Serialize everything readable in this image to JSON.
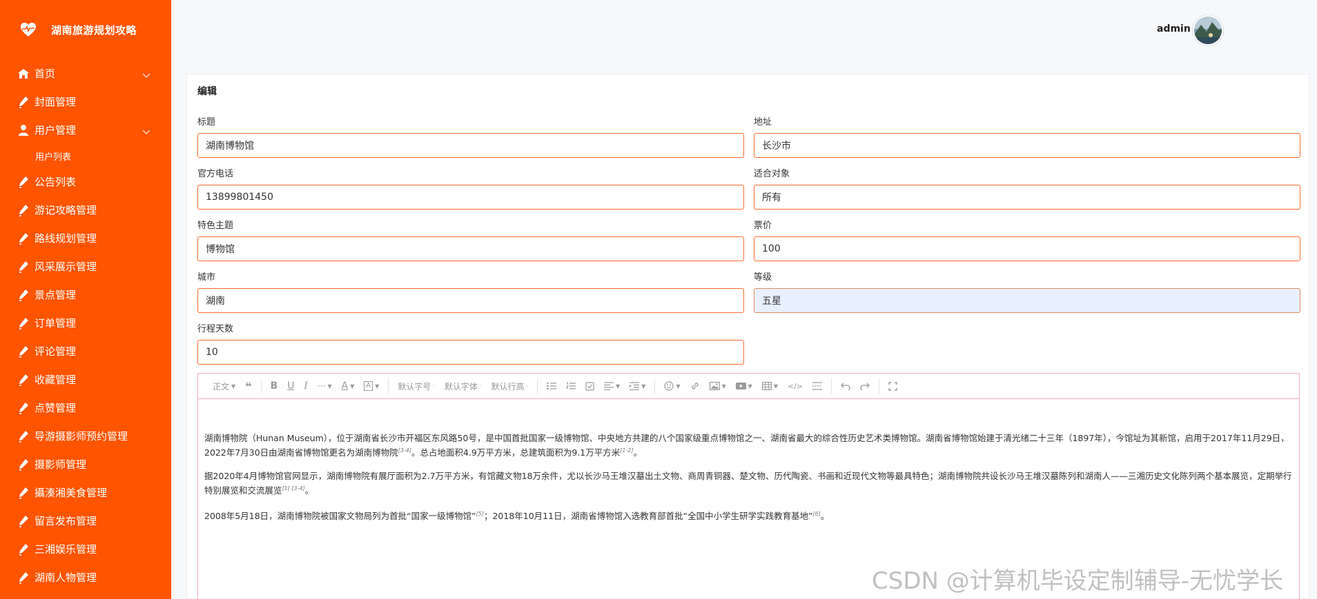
{
  "app": {
    "title": "湖南旅游规划攻略"
  },
  "sidebar": {
    "items": [
      {
        "label": "首页",
        "icon": "home-icon"
      },
      {
        "label": "封面管理",
        "icon": "pen-icon"
      },
      {
        "label": "用户管理",
        "icon": "user-icon"
      },
      {
        "label": "公告列表",
        "icon": "pen-icon"
      },
      {
        "label": "游记攻略管理",
        "icon": "pen-icon"
      },
      {
        "label": "路线规划管理",
        "icon": "pen-icon"
      },
      {
        "label": "风采展示管理",
        "icon": "pen-icon"
      },
      {
        "label": "景点管理",
        "icon": "pen-icon"
      },
      {
        "label": "订单管理",
        "icon": "pen-icon"
      },
      {
        "label": "评论管理",
        "icon": "pen-icon"
      },
      {
        "label": "收藏管理",
        "icon": "pen-icon"
      },
      {
        "label": "点赞管理",
        "icon": "pen-icon"
      },
      {
        "label": "导游摄影师预约管理",
        "icon": "pen-icon"
      },
      {
        "label": "摄影师管理",
        "icon": "pen-icon"
      },
      {
        "label": "攝湊湘美食管理",
        "icon": "pen-icon"
      },
      {
        "label": "留言发布管理",
        "icon": "pen-icon"
      },
      {
        "label": "三湘娱乐管理",
        "icon": "pen-icon"
      },
      {
        "label": "湖南人物管理",
        "icon": "pen-icon"
      }
    ],
    "submenu": {
      "user_list": "用户列表"
    },
    "bg_color": "#ff5400"
  },
  "header": {
    "username": "admin"
  },
  "form": {
    "title": "编辑",
    "fields": {
      "title": {
        "label": "标题",
        "value": "湖南博物馆"
      },
      "address": {
        "label": "地址",
        "value": "长沙市"
      },
      "phone": {
        "label": "官方电话",
        "value": "13899801450"
      },
      "audience": {
        "label": "适合对象",
        "value": "所有"
      },
      "theme": {
        "label": "特色主题",
        "value": "博物馆"
      },
      "price": {
        "label": "票价",
        "value": "100"
      },
      "city": {
        "label": "城市",
        "value": "湖南"
      },
      "level": {
        "label": "等级",
        "value": "五星"
      },
      "days": {
        "label": "行程天数",
        "value": "10"
      }
    }
  },
  "editor": {
    "toolbar": {
      "paragraph": "正文",
      "font_size": "默认字号",
      "font_family": "默认字体",
      "line_height": "默认行高"
    },
    "paragraphs": [
      {
        "text": "湖南博物院（Hunan Museum），位于湖南省长沙市开福区东风路50号，是中国首批国家一级博物馆、中央地方共建的八个国家级重点博物馆之一、湖南省最大的综合性历史艺术类博物馆。湖南省博物馆始建于清光绪二十三年（1897年），今馆址为其新馆，启用于2017年11月29日，2022年7月30日由湖南省博物馆更名为湖南博物院",
        "ref1": "[3-4]",
        "text2": "。总占地面积4.9万平方米，总建筑面积为9.1万平方米",
        "ref2": "[1-2]",
        "text3": "。"
      },
      {
        "text": "据2020年4月博物馆官网显示，湖南博物院有展厅面积为2.7万平方米，有馆藏文物18万余件，尤以长沙马王堆汉墓出土文物、商周青铜器、楚文物、历代陶瓷、书画和近现代文物等最具特色；湖南博物院共设长沙马王堆汉墓陈列和湖南人——三湘历史文化陈列两个基本展览，定期举行特别展览和交流展览",
        "ref1": "[1] [3-4]",
        "text2": "。"
      },
      {
        "text": "2008年5月18日，湖南博物院被国家文物局列为首批“国家一级博物馆”",
        "ref1": "[5]",
        "text2": "；2018年10月11日，湖南省博物馆入选教育部首批“全国中小学生研学实践教育基地”",
        "ref2": "[6]",
        "text3": "。"
      }
    ]
  },
  "watermark": "CSDN @计算机毕设定制辅导-无忧学长"
}
